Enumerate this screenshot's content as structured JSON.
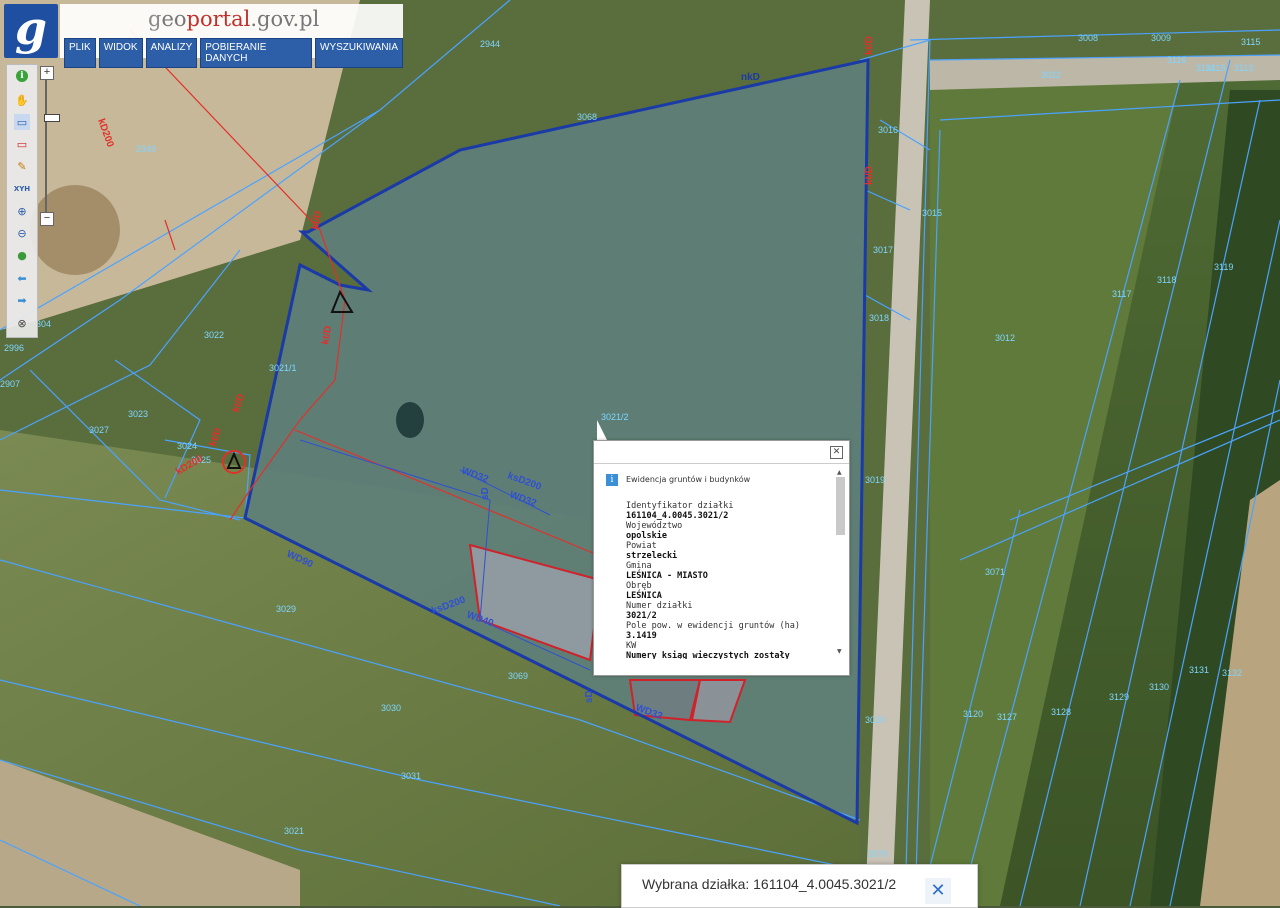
{
  "header": {
    "brand_g": "g",
    "brand_eo": "eo",
    "brand_portal": "portal",
    "brand_domain": ".gov.pl",
    "logo_letter": "g",
    "menu": [
      "PLIK",
      "WIDOK",
      "ANALIZY",
      "POBIERANIE DANYCH",
      "WYSZUKIWANIA"
    ]
  },
  "toolbar": {
    "zoom_in": "+",
    "zoom_out": "−",
    "tools": [
      {
        "icon": "info-icon",
        "glyph": "i"
      },
      {
        "icon": "hand-icon",
        "glyph": "✋"
      },
      {
        "icon": "select-rectangle-icon",
        "glyph": "▭"
      },
      {
        "icon": "remove-selection-icon",
        "glyph": "▭"
      },
      {
        "icon": "pencil-icon",
        "glyph": "✎"
      },
      {
        "icon": "xyh-coordinates-icon",
        "glyph": "XYH"
      },
      {
        "icon": "zoom-in-icon",
        "glyph": "⊕"
      },
      {
        "icon": "zoom-out-icon",
        "glyph": "⊖"
      },
      {
        "icon": "globe-icon",
        "glyph": "●"
      },
      {
        "icon": "arrow-left-icon",
        "glyph": "⬅"
      },
      {
        "icon": "arrow-right-icon",
        "glyph": "➡"
      },
      {
        "icon": "clear-icon",
        "glyph": "⊗"
      }
    ]
  },
  "map": {
    "parcels": [
      "3008",
      "3009",
      "3115",
      "3114",
      "3116",
      "3118",
      "3113",
      "3022",
      "3016",
      "3015",
      "3017",
      "3018",
      "3019",
      "3118",
      "3119",
      "3117",
      "3012",
      "3020",
      "3070",
      "3071",
      "3120",
      "3127",
      "3128",
      "3129",
      "3130",
      "3131",
      "3132",
      "2944",
      "2949",
      "3022",
      "3021/1",
      "3023",
      "3024",
      "3025",
      "3027",
      "2907",
      "2996",
      "3029",
      "3030",
      "3031",
      "3021",
      "3068",
      "3069",
      "3021/2",
      "304"
    ],
    "pipes": [
      "nkD",
      "kt/D",
      "kt/D",
      "kt/D",
      "kt/D",
      "kt/D",
      "kt/D",
      "WD32",
      "WD32",
      "ksD200",
      "ksD200",
      "WD40",
      "WD32",
      "WD90",
      "kD200",
      "kD200",
      "sD",
      "sD"
    ]
  },
  "popup": {
    "title": "Ewidencja gruntów i budynków",
    "fields": [
      {
        "label": "Identyfikator działki",
        "value": "161104_4.0045.3021/2"
      },
      {
        "label": "Województwo",
        "value": "opolskie"
      },
      {
        "label": "Powiat",
        "value": "strzelecki"
      },
      {
        "label": "Gmina",
        "value": "LEŚNICA - MIASTO"
      },
      {
        "label": "Obręb",
        "value": "LEŚNICA"
      },
      {
        "label": "Numer działki",
        "value": "3021/2"
      },
      {
        "label": "Pole pow. w ewidencji gruntów (ha)",
        "value": "3.1419"
      },
      {
        "label": "KW",
        "value": "Numery ksiąg wieczystych zostały"
      }
    ]
  },
  "selection": {
    "label": "Wybrana działka: 161104_4.0045.3021/2",
    "close": "✕"
  },
  "colors": {
    "parcel_line": "#4aa3ff",
    "selected_parcel": "#1a3aa8",
    "utility_red": "#e0312b",
    "menu_blue": "#2c5fa8"
  }
}
